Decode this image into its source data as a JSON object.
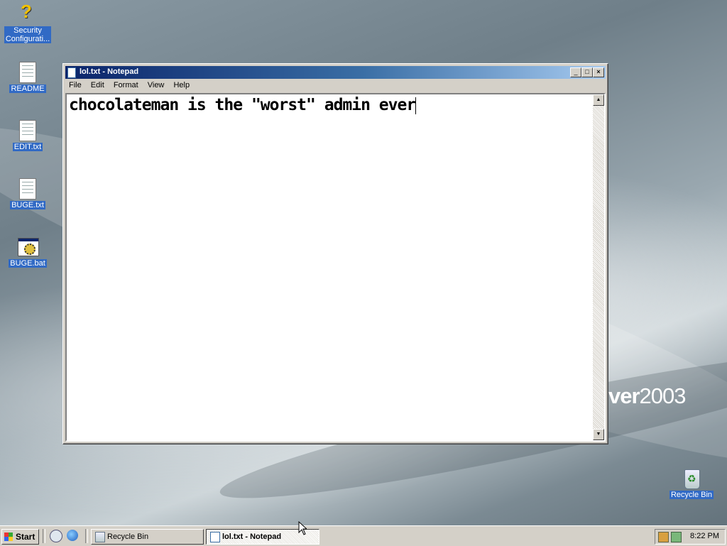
{
  "desktop": {
    "icons": [
      {
        "label_line1": "Security",
        "label_line2": "Configurati...",
        "icon": "security-config-icon"
      },
      {
        "label": "README",
        "icon": "text-document-icon"
      },
      {
        "label": "EDIT.txt",
        "icon": "text-document-icon"
      },
      {
        "label": "BUGE.txt",
        "icon": "text-document-icon"
      },
      {
        "label": "BUGE.bat",
        "icon": "batch-file-icon"
      },
      {
        "label": "Recycle Bin",
        "icon": "recycle-bin-icon"
      }
    ],
    "brand_text_a": "ver",
    "brand_text_b": "2003"
  },
  "window": {
    "title": "lol.txt - Notepad",
    "menu": [
      "File",
      "Edit",
      "Format",
      "View",
      "Help"
    ],
    "content": "chocolateman is the \"worst\" admin ever",
    "titlebar_color": "#0a246a"
  },
  "taskbar": {
    "start_label": "Start",
    "tasks": [
      {
        "label": "Recycle Bin",
        "active": false
      },
      {
        "label": "lol.txt - Notepad",
        "active": true
      }
    ],
    "clock": "8:22 PM"
  }
}
